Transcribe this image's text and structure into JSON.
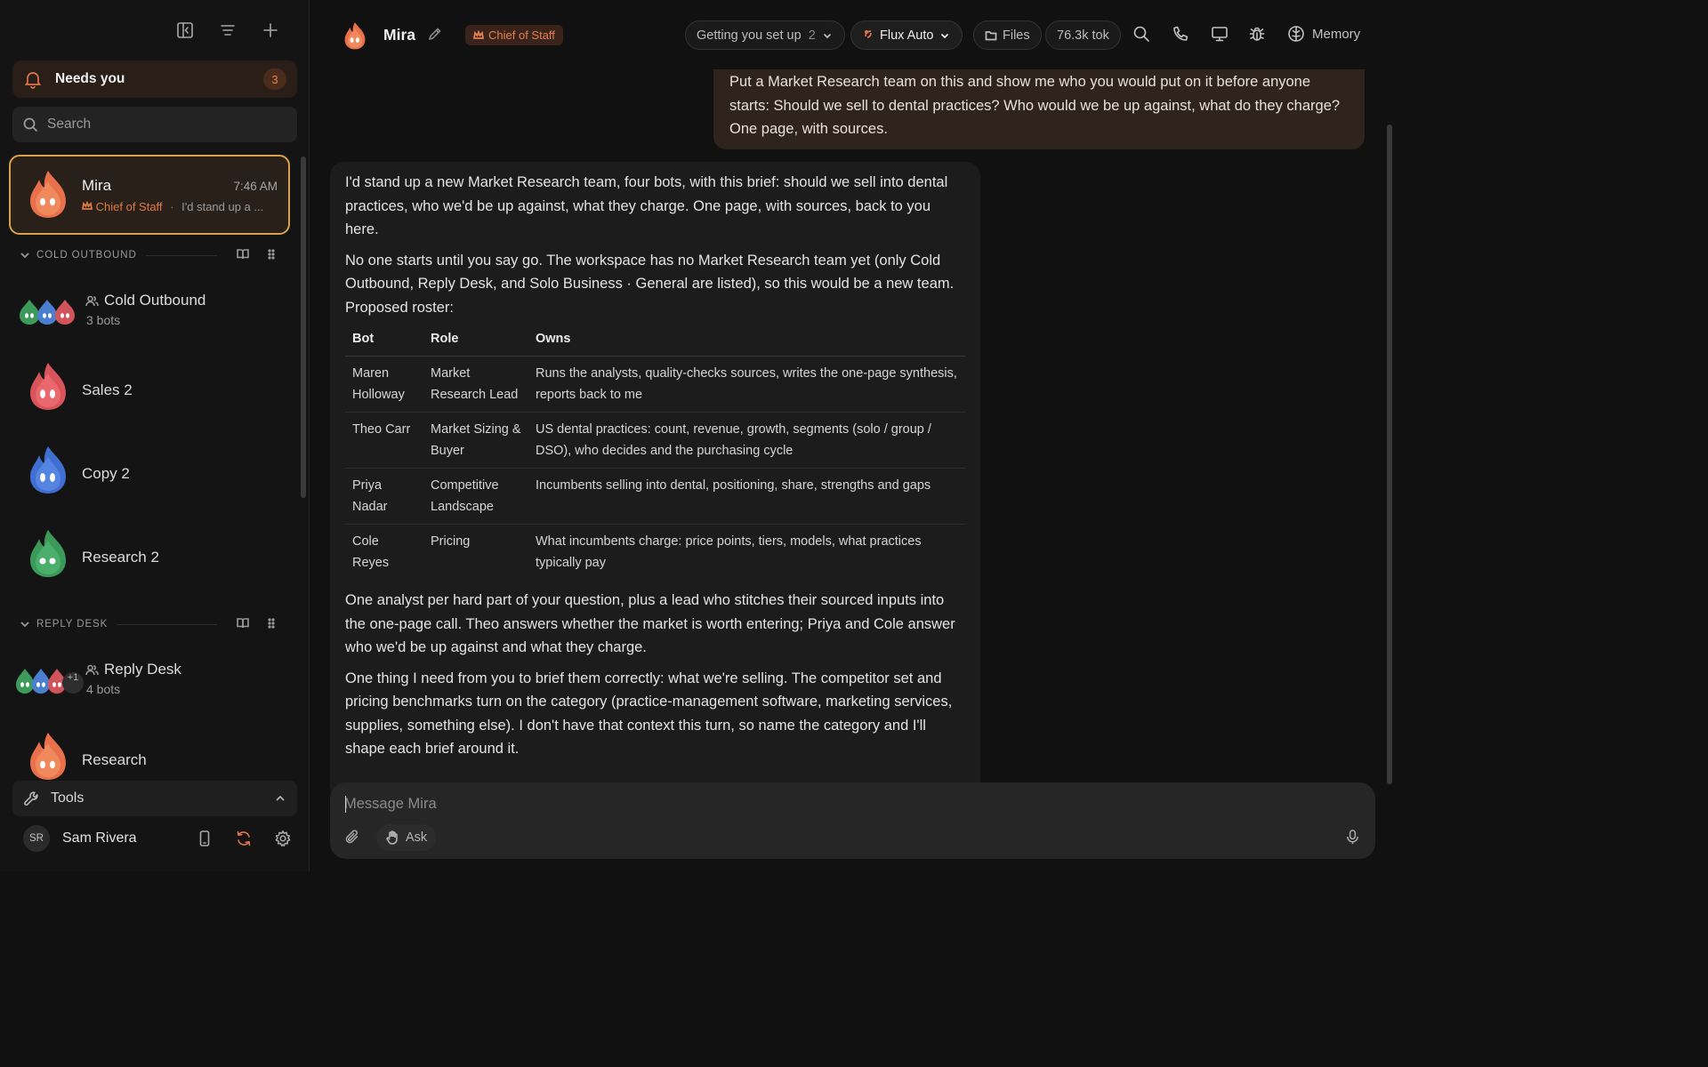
{
  "sidebar": {
    "needs": {
      "label": "Needs you",
      "count": "3"
    },
    "search": {
      "placeholder": "Search"
    },
    "active_chat": {
      "name": "Mira",
      "time": "7:46 AM",
      "role": "Chief of Staff",
      "preview": "I'd stand up a ..."
    },
    "sections": [
      {
        "title": "COLD OUTBOUND"
      },
      {
        "title": "REPLY DESK"
      }
    ],
    "cold_outbound": {
      "team_name": "Cold Outbound",
      "team_sub": "3 bots",
      "bots": [
        "Sales 2",
        "Copy 2",
        "Research 2"
      ]
    },
    "reply_desk": {
      "team_name": "Reply Desk",
      "team_sub": "4 bots",
      "extra": "+1",
      "bots": [
        "Research"
      ]
    },
    "tools_label": "Tools",
    "user": {
      "initials": "SR",
      "name": "Sam Rivera"
    }
  },
  "header": {
    "name": "Mira",
    "badge": "Chief of Staff",
    "setup": {
      "label": "Getting you set up",
      "count": "2"
    },
    "model": "Flux Auto",
    "files": "Files",
    "tokens": "76.3k tok",
    "memory": "Memory"
  },
  "messages": {
    "user": "Put a Market Research team on this and show me who you would put on it before anyone starts: Should we sell to dental practices? Who would we be up against, what do they charge? One page, with sources.",
    "bot": {
      "p1": "I'd stand up a new Market Research team, four bots, with this brief: should we sell into dental practices, who we'd be up against, what they charge. One page, with sources, back to you here.",
      "p2": "No one starts until you say go. The workspace has no Market Research team yet (only Cold Outbound, Reply Desk, and Solo Business · General are listed), so this would be a new team. Proposed roster:",
      "table": {
        "headers": [
          "Bot",
          "Role",
          "Owns"
        ],
        "rows": [
          [
            "Maren Holloway",
            "Market Research Lead",
            "Runs the analysts, quality-checks sources, writes the one-page synthesis, reports back to me"
          ],
          [
            "Theo Carr",
            "Market Sizing & Buyer",
            "US dental practices: count, revenue, growth, segments (solo / group / DSO), who decides and the purchasing cycle"
          ],
          [
            "Priya Nadar",
            "Competitive Landscape",
            "Incumbents selling into dental, positioning, share, strengths and gaps"
          ],
          [
            "Cole Reyes",
            "Pricing",
            "What incumbents charge: price points, tiers, models, what practices typically pay"
          ]
        ]
      },
      "p3": "One analyst per hard part of your question, plus a lead who stitches their sourced inputs into the one-page call. Theo answers whether the market is worth entering; Priya and Cole answer who we'd be up against and what they charge.",
      "p4": "One thing I need from you to brief them correctly: what we're selling. The competitor set and pricing benchmarks turn on the category (practice-management software, marketing services, supplies, something else). I don't have that context this turn, so name the category and I'll shape each brief around it."
    }
  },
  "composer": {
    "placeholder": "Message Mira",
    "ask_label": "Ask"
  },
  "colors": {
    "accent": "#e0764a",
    "active_border": "#d9a24a",
    "bot_bubble": "#1c1c1c",
    "user_bubble": "#2e241d"
  }
}
